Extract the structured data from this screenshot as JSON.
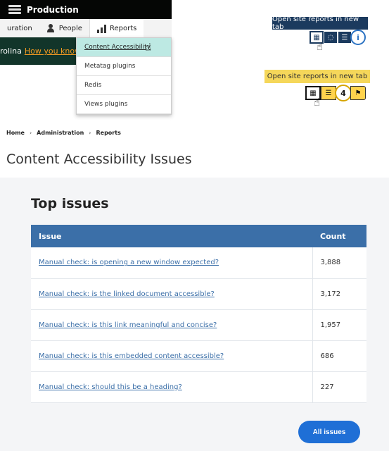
{
  "toolbar": {
    "environment": "Production",
    "tabs": [
      {
        "label": "uration"
      },
      {
        "label": "People"
      },
      {
        "label": "Reports"
      }
    ],
    "strip_text": "rolina",
    "strip_link": "How you know"
  },
  "reports_menu": {
    "items": [
      "Content Accessibility",
      "Metatag plugins",
      "Redis",
      "Views plugins"
    ]
  },
  "tooltip_blue": {
    "text": "Open site reports in new tab",
    "info": "i"
  },
  "tooltip_yellow": {
    "text": "Open site reports in new tab",
    "count": "4"
  },
  "breadcrumb": [
    "Home",
    "Administration",
    "Reports"
  ],
  "page_title": "Content Accessibility Issues",
  "section_title": "Top issues",
  "table": {
    "headers": [
      "Issue",
      "Count"
    ],
    "rows": [
      {
        "issue": "Manual check: is opening a new window expected?",
        "count": "3,888"
      },
      {
        "issue": "Manual check: is the linked document accessible?",
        "count": "3,172"
      },
      {
        "issue": "Manual check: is this link meaningful and concise?",
        "count": "1,957"
      },
      {
        "issue": "Manual check: is this embedded content accessible?",
        "count": "686"
      },
      {
        "issue": "Manual check: should this be a heading?",
        "count": "227"
      }
    ]
  },
  "all_issues_label": "All issues",
  "colors": {
    "table_header": "#3b6fa8",
    "button": "#1f6fd6",
    "tooltip_blue": "#1b3a5e",
    "tooltip_yellow": "#f5d75a",
    "menu_active": "#bde9e3"
  }
}
